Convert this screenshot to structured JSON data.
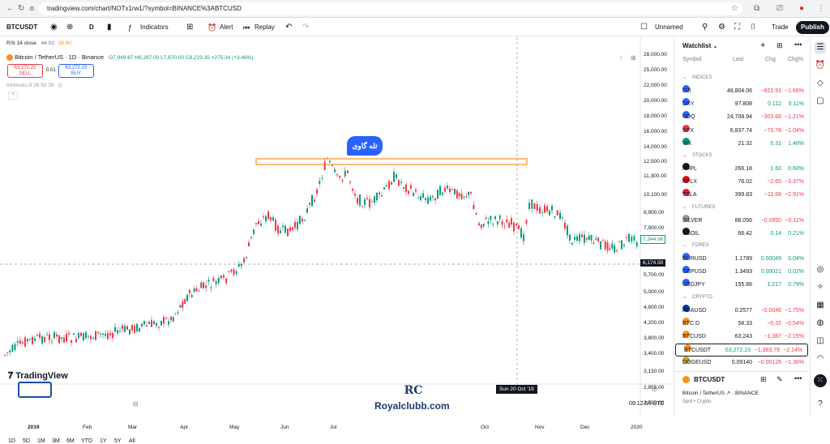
{
  "browser": {
    "url": "tradingview.com/chart/NOTx1rw1/?symbol=BINANCE%3ABTCUSD"
  },
  "toolbar": {
    "symbol": "BTCUSDT",
    "interval": "D",
    "indicators": "Indicators",
    "alert": "Alert",
    "replay": "Replay",
    "layout_name": "Unnamed",
    "trade": "Trade",
    "publish": "Publish"
  },
  "legend": {
    "rsi": "RSI 14 close",
    "rsi_v1": "44.02",
    "rsi_v2": "38.90",
    "title": "Bitcoin / TetherUS · 1D · Binance",
    "ohlc": "O7,949.87 H8,297.00 L7,870.00 C8,223.35 +275.34 (+3.46%)",
    "sell_price": "63,272.22",
    "sell_label": "SELL",
    "spread": "0.01",
    "buy_price": "63,272.23",
    "buy_label": "BUY",
    "ichimoku": "Ichimoku 9 26 52 26"
  },
  "annotation": {
    "label": "تله گاوی",
    "color": "#2962ff",
    "box_color": "#f7931a"
  },
  "price_axis": {
    "ticks": [
      "28,000.00",
      "25,000.00",
      "22,000.00",
      "20,000.00",
      "18,000.00",
      "16,000.00",
      "14,000.00",
      "12,500.00",
      "11,300.00",
      "10,100.00",
      "8,900.00",
      "7,900.00",
      "7,344.96",
      "6,174.50",
      "5,700.00",
      "5,000.00",
      "4,600.00",
      "4,200.00",
      "3,800.00",
      "3,400.00",
      "3,130.00",
      "2,855.00",
      "2,595.00"
    ],
    "current_price": "7,344.96",
    "crosshair_price": "6,174.50"
  },
  "time_axis": {
    "labels": [
      "2019",
      "Feb",
      "Mar",
      "Apr",
      "May",
      "Jun",
      "Jul",
      "Oct",
      "Nov",
      "Dec",
      "2020"
    ],
    "crosshair_date": "Sun 20 Oct '19"
  },
  "ranges": [
    "1D",
    "5D",
    "1M",
    "3M",
    "6M",
    "YTD",
    "1Y",
    "5Y",
    "All"
  ],
  "clock": "09:12:54 UTC",
  "logo": {
    "tradingview": "TradingView",
    "watermark": "Royalclubb.com",
    "watermark_mark": "RC"
  },
  "watchlist": {
    "title": "Watchlist",
    "columns": {
      "symbol": "Symbol",
      "last": "Last",
      "chg": "Chg",
      "chgp": "Chg%"
    },
    "sections": [
      {
        "name": "INDICES",
        "rows": [
          {
            "sym": "DJI",
            "last": "48,804.06",
            "chg": "−821.91",
            "chgp": "−1.66%",
            "neg": true,
            "color": "#2962ff"
          },
          {
            "sym": "DXY",
            "last": "97.808",
            "chg": "0.112",
            "chgp": "0.11%",
            "neg": false,
            "color": "#2962ff"
          },
          {
            "sym": "NDQ",
            "last": "24,708.94",
            "chg": "−303.68",
            "chgp": "−1.21%",
            "neg": true,
            "color": "#2962ff"
          },
          {
            "sym": "SPX",
            "last": "6,837.74",
            "chg": "−71.78",
            "chgp": "−1.04%",
            "neg": true,
            "color": "#f23645"
          },
          {
            "sym": "VIX",
            "last": "21.32",
            "chg": "0.31",
            "chgp": "1.48%",
            "neg": false,
            "color": "#089981"
          }
        ]
      },
      {
        "name": "STOCKS",
        "rows": [
          {
            "sym": "AAPL",
            "last": "266.18",
            "chg": "1.60",
            "chgp": "0.60%",
            "neg": false,
            "color": "#131722"
          },
          {
            "sym": "NFLX",
            "last": "76.02",
            "chg": "−2.65",
            "chgp": "−3.37%",
            "neg": true,
            "color": "#e50914"
          },
          {
            "sym": "TSLA",
            "last": "399.83",
            "chg": "−11.99",
            "chgp": "−2.91%",
            "neg": true,
            "color": "#e31937"
          }
        ]
      },
      {
        "name": "FUTURES",
        "rows": [
          {
            "sym": "SILVER",
            "last": "88.056",
            "chg": "−0.0950",
            "chgp": "−0.11%",
            "neg": true,
            "color": "#9598a1"
          },
          {
            "sym": "USOIL",
            "last": "66.42",
            "chg": "0.14",
            "chgp": "0.21%",
            "neg": false,
            "color": "#131722"
          }
        ]
      },
      {
        "name": "FOREX",
        "rows": [
          {
            "sym": "EURUSD",
            "last": "1.1789",
            "chg": "0.00049",
            "chgp": "0.04%",
            "neg": false,
            "color": "#2962ff"
          },
          {
            "sym": "GBPUSD",
            "last": "1.3493",
            "chg": "0.00021",
            "chgp": "0.02%",
            "neg": false,
            "color": "#2962ff"
          },
          {
            "sym": "USDJPY",
            "last": "155.86",
            "chg": "1.217",
            "chgp": "0.79%",
            "neg": false,
            "color": "#2962ff"
          }
        ]
      },
      {
        "name": "CRYPTO",
        "rows": [
          {
            "sym": "ADAUSD",
            "last": "0.2577",
            "chg": "−0.0046",
            "chgp": "−1.75%",
            "neg": true,
            "color": "#0033ad"
          },
          {
            "sym": "BTC.D",
            "last": "58.33",
            "chg": "−0.32",
            "chgp": "−0.54%",
            "neg": true,
            "color": "#f7931a"
          },
          {
            "sym": "BTCUSD",
            "last": "63,243",
            "chg": "−1,387",
            "chgp": "−2.15%",
            "neg": true,
            "color": "#f7931a"
          },
          {
            "sym": "BTCUSDT",
            "last": "63,272.23",
            "chg": "−1,383.79",
            "chgp": "−2.14%",
            "neg": true,
            "color": "#f7931a"
          },
          {
            "sym": "DOGEUSD",
            "last": "0.09140",
            "chg": "−0.00126",
            "chgp": "−1.36%",
            "neg": true,
            "color": "#c2a633"
          }
        ]
      }
    ],
    "details": {
      "symbol": "BTCUSDT",
      "name": "Bitcoin / TetherUS",
      "exchange": "BINANCE",
      "type": "Spot • Crypto"
    }
  }
}
